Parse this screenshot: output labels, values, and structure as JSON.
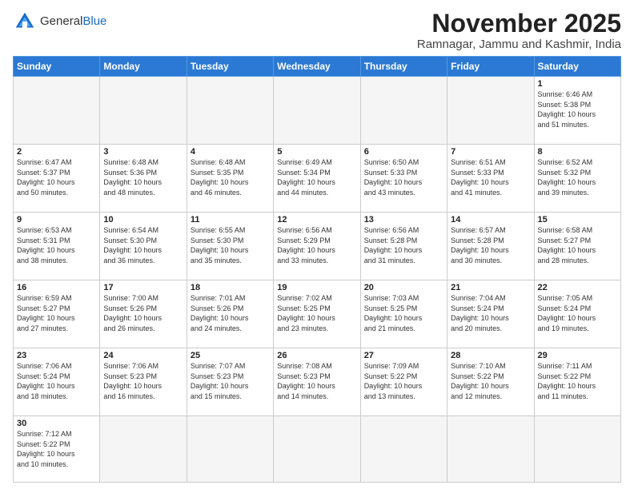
{
  "header": {
    "logo_general": "General",
    "logo_blue": "Blue",
    "month_title": "November 2025",
    "location": "Ramnagar, Jammu and Kashmir, India"
  },
  "weekdays": [
    "Sunday",
    "Monday",
    "Tuesday",
    "Wednesday",
    "Thursday",
    "Friday",
    "Saturday"
  ],
  "weeks": [
    [
      {
        "day": "",
        "info": ""
      },
      {
        "day": "",
        "info": ""
      },
      {
        "day": "",
        "info": ""
      },
      {
        "day": "",
        "info": ""
      },
      {
        "day": "",
        "info": ""
      },
      {
        "day": "",
        "info": ""
      },
      {
        "day": "1",
        "info": "Sunrise: 6:46 AM\nSunset: 5:38 PM\nDaylight: 10 hours\nand 51 minutes."
      }
    ],
    [
      {
        "day": "2",
        "info": "Sunrise: 6:47 AM\nSunset: 5:37 PM\nDaylight: 10 hours\nand 50 minutes."
      },
      {
        "day": "3",
        "info": "Sunrise: 6:48 AM\nSunset: 5:36 PM\nDaylight: 10 hours\nand 48 minutes."
      },
      {
        "day": "4",
        "info": "Sunrise: 6:48 AM\nSunset: 5:35 PM\nDaylight: 10 hours\nand 46 minutes."
      },
      {
        "day": "5",
        "info": "Sunrise: 6:49 AM\nSunset: 5:34 PM\nDaylight: 10 hours\nand 44 minutes."
      },
      {
        "day": "6",
        "info": "Sunrise: 6:50 AM\nSunset: 5:33 PM\nDaylight: 10 hours\nand 43 minutes."
      },
      {
        "day": "7",
        "info": "Sunrise: 6:51 AM\nSunset: 5:33 PM\nDaylight: 10 hours\nand 41 minutes."
      },
      {
        "day": "8",
        "info": "Sunrise: 6:52 AM\nSunset: 5:32 PM\nDaylight: 10 hours\nand 39 minutes."
      }
    ],
    [
      {
        "day": "9",
        "info": "Sunrise: 6:53 AM\nSunset: 5:31 PM\nDaylight: 10 hours\nand 38 minutes."
      },
      {
        "day": "10",
        "info": "Sunrise: 6:54 AM\nSunset: 5:30 PM\nDaylight: 10 hours\nand 36 minutes."
      },
      {
        "day": "11",
        "info": "Sunrise: 6:55 AM\nSunset: 5:30 PM\nDaylight: 10 hours\nand 35 minutes."
      },
      {
        "day": "12",
        "info": "Sunrise: 6:56 AM\nSunset: 5:29 PM\nDaylight: 10 hours\nand 33 minutes."
      },
      {
        "day": "13",
        "info": "Sunrise: 6:56 AM\nSunset: 5:28 PM\nDaylight: 10 hours\nand 31 minutes."
      },
      {
        "day": "14",
        "info": "Sunrise: 6:57 AM\nSunset: 5:28 PM\nDaylight: 10 hours\nand 30 minutes."
      },
      {
        "day": "15",
        "info": "Sunrise: 6:58 AM\nSunset: 5:27 PM\nDaylight: 10 hours\nand 28 minutes."
      }
    ],
    [
      {
        "day": "16",
        "info": "Sunrise: 6:59 AM\nSunset: 5:27 PM\nDaylight: 10 hours\nand 27 minutes."
      },
      {
        "day": "17",
        "info": "Sunrise: 7:00 AM\nSunset: 5:26 PM\nDaylight: 10 hours\nand 26 minutes."
      },
      {
        "day": "18",
        "info": "Sunrise: 7:01 AM\nSunset: 5:26 PM\nDaylight: 10 hours\nand 24 minutes."
      },
      {
        "day": "19",
        "info": "Sunrise: 7:02 AM\nSunset: 5:25 PM\nDaylight: 10 hours\nand 23 minutes."
      },
      {
        "day": "20",
        "info": "Sunrise: 7:03 AM\nSunset: 5:25 PM\nDaylight: 10 hours\nand 21 minutes."
      },
      {
        "day": "21",
        "info": "Sunrise: 7:04 AM\nSunset: 5:24 PM\nDaylight: 10 hours\nand 20 minutes."
      },
      {
        "day": "22",
        "info": "Sunrise: 7:05 AM\nSunset: 5:24 PM\nDaylight: 10 hours\nand 19 minutes."
      }
    ],
    [
      {
        "day": "23",
        "info": "Sunrise: 7:06 AM\nSunset: 5:24 PM\nDaylight: 10 hours\nand 18 minutes."
      },
      {
        "day": "24",
        "info": "Sunrise: 7:06 AM\nSunset: 5:23 PM\nDaylight: 10 hours\nand 16 minutes."
      },
      {
        "day": "25",
        "info": "Sunrise: 7:07 AM\nSunset: 5:23 PM\nDaylight: 10 hours\nand 15 minutes."
      },
      {
        "day": "26",
        "info": "Sunrise: 7:08 AM\nSunset: 5:23 PM\nDaylight: 10 hours\nand 14 minutes."
      },
      {
        "day": "27",
        "info": "Sunrise: 7:09 AM\nSunset: 5:22 PM\nDaylight: 10 hours\nand 13 minutes."
      },
      {
        "day": "28",
        "info": "Sunrise: 7:10 AM\nSunset: 5:22 PM\nDaylight: 10 hours\nand 12 minutes."
      },
      {
        "day": "29",
        "info": "Sunrise: 7:11 AM\nSunset: 5:22 PM\nDaylight: 10 hours\nand 11 minutes."
      }
    ],
    [
      {
        "day": "30",
        "info": "Sunrise: 7:12 AM\nSunset: 5:22 PM\nDaylight: 10 hours\nand 10 minutes."
      },
      {
        "day": "",
        "info": ""
      },
      {
        "day": "",
        "info": ""
      },
      {
        "day": "",
        "info": ""
      },
      {
        "day": "",
        "info": ""
      },
      {
        "day": "",
        "info": ""
      },
      {
        "day": "",
        "info": ""
      }
    ]
  ]
}
